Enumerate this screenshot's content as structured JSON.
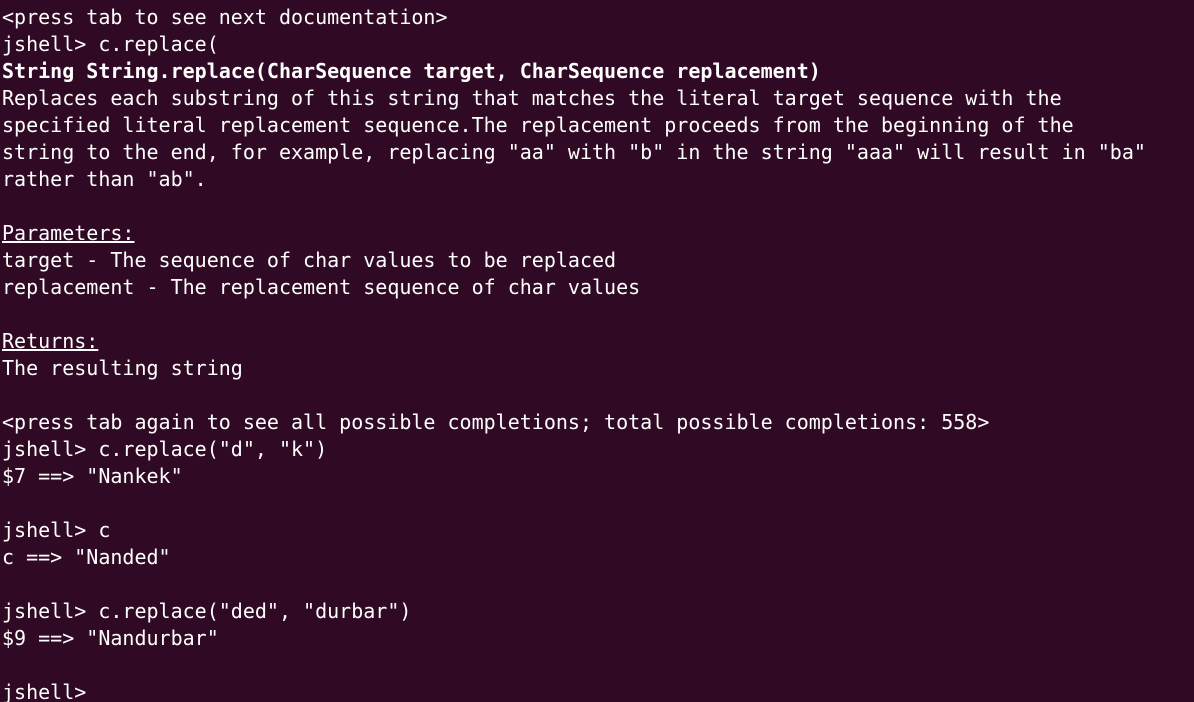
{
  "terminal": {
    "background_color": "#300a24",
    "text_color": "#ffffff",
    "lines": [
      {
        "text": "<press tab to see next documentation>",
        "style": "normal"
      },
      {
        "text": "jshell> c.replace(",
        "style": "normal"
      },
      {
        "text": "String String.replace(CharSequence target, CharSequence replacement)",
        "style": "bold"
      },
      {
        "text": "Replaces each substring of this string that matches the literal target sequence with the",
        "style": "normal"
      },
      {
        "text": "specified literal replacement sequence.The replacement proceeds from the beginning of the",
        "style": "normal"
      },
      {
        "text": "string to the end, for example, replacing \"aa\" with \"b\" in the string \"aaa\" will result in \"ba\"",
        "style": "normal"
      },
      {
        "text": "rather than \"ab\".",
        "style": "normal"
      },
      {
        "text": "",
        "style": "normal"
      },
      {
        "text": "Parameters:",
        "style": "underline"
      },
      {
        "text": "target - The sequence of char values to be replaced",
        "style": "normal"
      },
      {
        "text": "replacement - The replacement sequence of char values",
        "style": "normal"
      },
      {
        "text": "",
        "style": "normal"
      },
      {
        "text": "Returns:",
        "style": "underline"
      },
      {
        "text": "The resulting string",
        "style": "normal"
      },
      {
        "text": "",
        "style": "normal"
      },
      {
        "text": "<press tab again to see all possible completions; total possible completions: 558>",
        "style": "normal"
      },
      {
        "text": "jshell> c.replace(\"d\", \"k\")",
        "style": "normal"
      },
      {
        "text": "$7 ==> \"Nankek\"",
        "style": "normal"
      },
      {
        "text": "",
        "style": "normal"
      },
      {
        "text": "jshell> c",
        "style": "normal"
      },
      {
        "text": "c ==> \"Nanded\"",
        "style": "normal"
      },
      {
        "text": "",
        "style": "normal"
      },
      {
        "text": "jshell> c.replace(\"ded\", \"durbar\")",
        "style": "normal"
      },
      {
        "text": "$9 ==> \"Nandurbar\"",
        "style": "normal"
      },
      {
        "text": "",
        "style": "normal"
      },
      {
        "text": "jshell> ",
        "style": "normal"
      }
    ]
  }
}
